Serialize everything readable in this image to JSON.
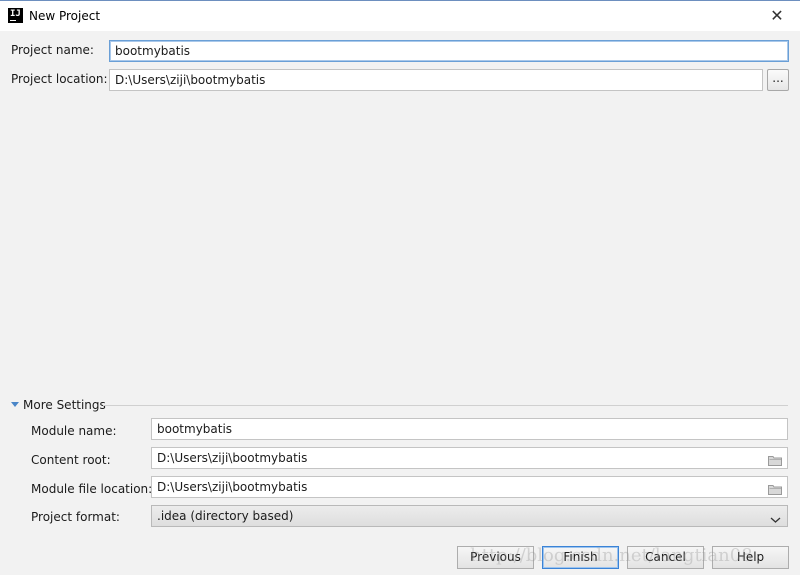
{
  "window": {
    "title": "New Project",
    "app_icon_text": "IJ",
    "close_glyph": "✕"
  },
  "project": {
    "name_label": "Project name:",
    "name_value": "bootmybatis",
    "location_label": "Project location:",
    "location_value": "D:\\Users\\ziji\\bootmybatis",
    "browse_label": "..."
  },
  "more_settings": {
    "title": "More Settings",
    "expanded": true,
    "module_name_label": "Module name:",
    "module_name_value": "bootmybatis",
    "content_root_label": "Content root:",
    "content_root_value": "D:\\Users\\ziji\\bootmybatis",
    "module_file_location_label": "Module file location:",
    "module_file_location_value": "D:\\Users\\ziji\\bootmybatis",
    "project_format_label": "Project format:",
    "project_format_value": ".idea (directory based)"
  },
  "buttons": {
    "previous": "Previous",
    "finish": "Finish",
    "cancel": "Cancel",
    "help": "Help"
  },
  "watermark": "http://blog.csdn.net/langtian08",
  "colors": {
    "focus_border": "#6a9fd6",
    "default_button_border": "#3b83d6",
    "background": "#f2f2f2"
  },
  "icons": {
    "app": "intellij-icon",
    "close": "close-icon",
    "toggle": "triangle-down-icon",
    "folder": "folder-icon",
    "dropdown": "chevron-down-icon"
  }
}
